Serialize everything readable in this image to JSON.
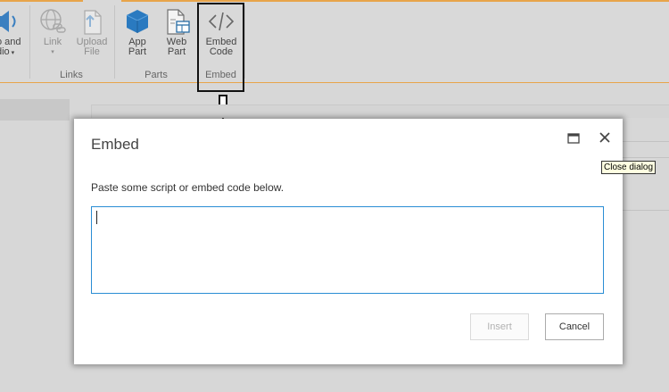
{
  "ribbon": {
    "buttons": {
      "video_audio": {
        "line1": "o and",
        "line2": "dio"
      },
      "link": {
        "label": "Link"
      },
      "upload_file": {
        "line1": "Upload",
        "line2": "File"
      },
      "app_part": {
        "line1": "App",
        "line2": "Part"
      },
      "web_part": {
        "line1": "Web",
        "line2": "Part"
      },
      "embed_code": {
        "line1": "Embed",
        "line2": "Code"
      }
    },
    "groups": {
      "links": "Links",
      "parts": "Parts",
      "embed": "Embed"
    },
    "accent_color": "#e8a44a"
  },
  "dialog": {
    "title": "Embed",
    "instruction": "Paste some script or embed code below.",
    "code_value": "",
    "insert_label": "Insert",
    "cancel_label": "Cancel",
    "close_tooltip": "Close dialog",
    "input_border_color": "#2a8dd4"
  },
  "icons": {
    "video_audio": "speaker-icon",
    "link": "globe-link-icon",
    "upload_file": "upload-file-icon",
    "app_part": "app-part-cube-icon",
    "web_part": "web-part-icon",
    "embed_code": "code-brackets-icon",
    "maximize": "maximize-icon",
    "close": "close-icon",
    "annotation": "down-arrow-icon"
  }
}
